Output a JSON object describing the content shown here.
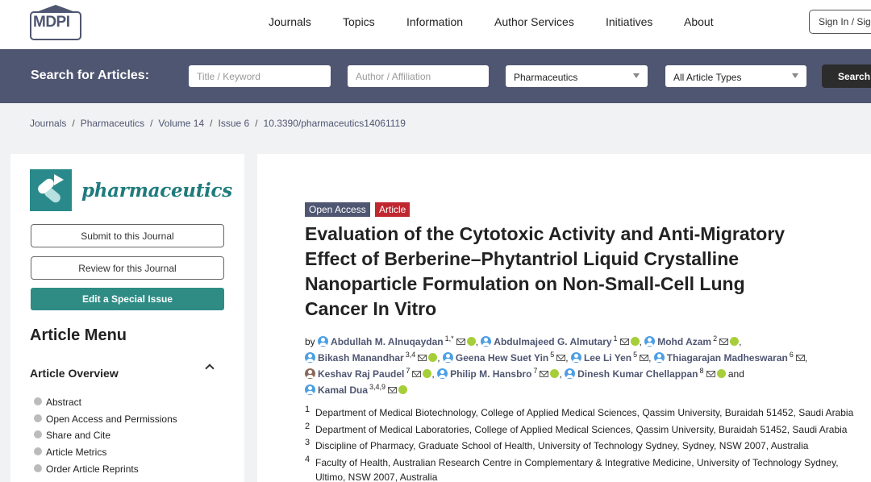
{
  "header": {
    "logo_text": "MDPI",
    "nav": [
      "Journals",
      "Topics",
      "Information",
      "Author Services",
      "Initiatives",
      "About"
    ],
    "signin_label": "Sign In / Sign Up"
  },
  "search": {
    "label": "Search for Articles:",
    "keyword_placeholder": "Title / Keyword",
    "author_placeholder": "Author / Affiliation",
    "journal_value": "Pharmaceutics",
    "type_value": "All Article Types",
    "button_label": "Search"
  },
  "breadcrumb": [
    "Journals",
    "Pharmaceutics",
    "Volume 14",
    "Issue 6",
    "10.3390/pharmaceutics14061119"
  ],
  "sidebar": {
    "journal_name": "pharmaceutics",
    "submit_label": "Submit to this Journal",
    "review_label": "Review for this Journal",
    "special_issue_label": "Edit a Special Issue",
    "menu_title": "Article Menu",
    "overview_title": "Article Overview",
    "items": [
      "Abstract",
      "Open Access and Permissions",
      "Share and Cite",
      "Article Metrics",
      "Order Article Reprints"
    ]
  },
  "article": {
    "badges": [
      "Open Access",
      "Article"
    ],
    "title_lines": [
      "Evaluation of the Cytotoxic Activity and Anti-Migratory",
      "Effect of Berberine–Phytantriol Liquid Crystalline",
      "Nanoparticle Formulation on Non-Small-Cell Lung",
      "Cancer In Vitro"
    ],
    "by": "by",
    "and": "and",
    "authors": [
      {
        "name": "Abdullah M. Alnuqaydan",
        "sup": "1,*"
      },
      {
        "name": "Abdulmajeed G. Almutary",
        "sup": "1"
      },
      {
        "name": "Mohd Azam",
        "sup": "2"
      },
      {
        "name": "Bikash Manandhar",
        "sup": "3,4"
      },
      {
        "name": "Geena Hew Suet Yin",
        "sup": "5"
      },
      {
        "name": "Lee Li Yen",
        "sup": "5"
      },
      {
        "name": "Thiagarajan Madheswaran",
        "sup": "6"
      },
      {
        "name": "Keshav Raj Paudel",
        "sup": "7"
      },
      {
        "name": "Philip M. Hansbro",
        "sup": "7"
      },
      {
        "name": "Dinesh Kumar Chellappan",
        "sup": "8"
      },
      {
        "name": "Kamal Dua",
        "sup": "3,4,9"
      }
    ],
    "affiliations": [
      {
        "num": "1",
        "text": "Department of Medical Biotechnology, College of Applied Medical Sciences, Qassim University, Buraidah 51452, Saudi Arabia"
      },
      {
        "num": "2",
        "text": "Department of Medical Laboratories, College of Applied Medical Sciences, Qassim University, Buraidah 51452, Saudi Arabia"
      },
      {
        "num": "3",
        "text": "Discipline of Pharmacy, Graduate School of Health, University of Technology Sydney, Sydney, NSW 2007, Australia"
      },
      {
        "num": "4",
        "text": "Faculty of Health, Australian Research Centre in Complementary & Integrative Medicine, University of Technology Sydney,",
        "text2": "Ultimo, NSW 2007, Australia"
      }
    ]
  },
  "colors": {
    "nav_bar": "#4f5671",
    "accent_teal": "#2e8c85",
    "badge_open": "#4f5671",
    "badge_article": "#c0282f"
  }
}
